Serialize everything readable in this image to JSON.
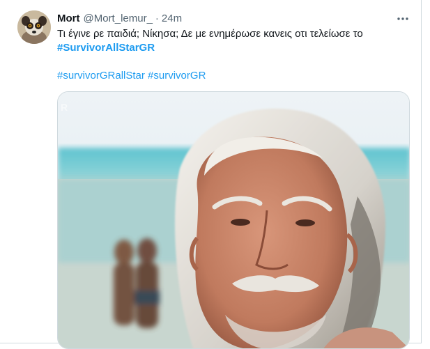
{
  "tweet": {
    "display_name": "Mort",
    "handle": "@Mort_lemur_",
    "separator": "·",
    "timestamp": "24m",
    "more_label": "···",
    "text_line": "Τι έγινε ρε παιδιά; Νίκησα; Δε με ενημέρωσε κανεις οτι τελείωσε το",
    "hashtag_main": "#SurvivorAllStarGR",
    "hashtag_1": "#survivorGRallStar",
    "hashtag_2": "#survivorGR",
    "media_watermark": "R"
  },
  "icons": {
    "more": "more-horizontal-icon",
    "avatar": "lemur-avatar"
  },
  "colors": {
    "link": "#1d9bf0",
    "secondary_text": "#536471",
    "primary_text": "#0f1419",
    "border": "#cfd9de"
  }
}
